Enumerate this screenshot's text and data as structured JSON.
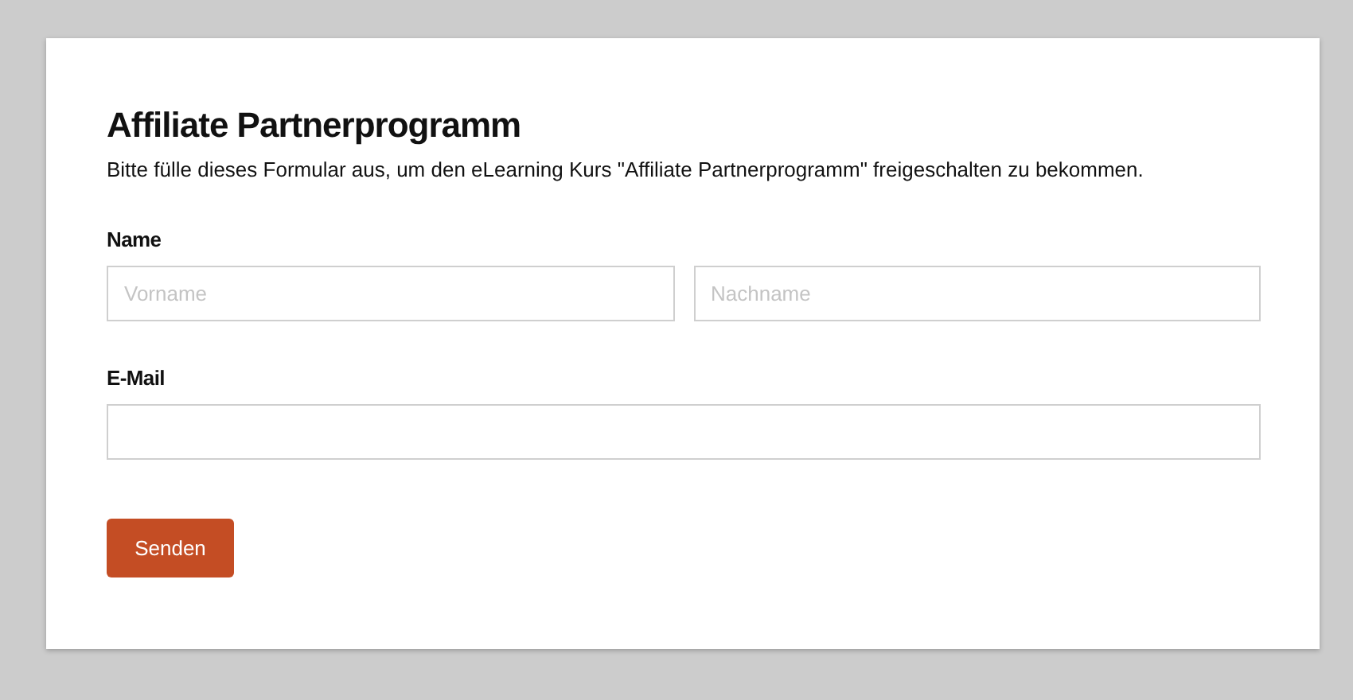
{
  "form": {
    "title": "Affiliate Partnerprogramm",
    "description": "Bitte fülle dieses Formular aus, um den eLearning Kurs \"Affiliate Partnerprogramm\" freigeschalten zu bekommen.",
    "name": {
      "label": "Name",
      "fields": [
        {
          "placeholder": "Vorname"
        },
        {
          "placeholder": "Nachname"
        }
      ]
    },
    "email": {
      "label": "E-Mail"
    },
    "submit": "Senden"
  }
}
